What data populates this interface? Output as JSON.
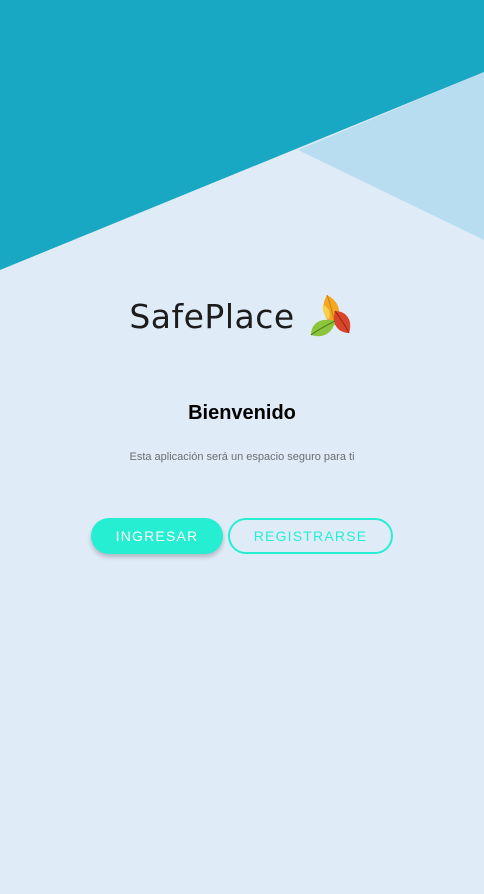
{
  "app": {
    "logo_text": "SafePlace",
    "logo_icon": "autumn-leaves-icon"
  },
  "welcome": {
    "title": "Bienvenido",
    "subtitle": "Esta aplicación será un espacio seguro para ti"
  },
  "actions": {
    "login_label": "INGRESAR",
    "register_label": "REGISTRARSE"
  },
  "colors": {
    "header_teal": "#18a8c4",
    "header_light": "#b9ddf0",
    "background": "#e0ebf8",
    "accent": "#25eed3"
  }
}
